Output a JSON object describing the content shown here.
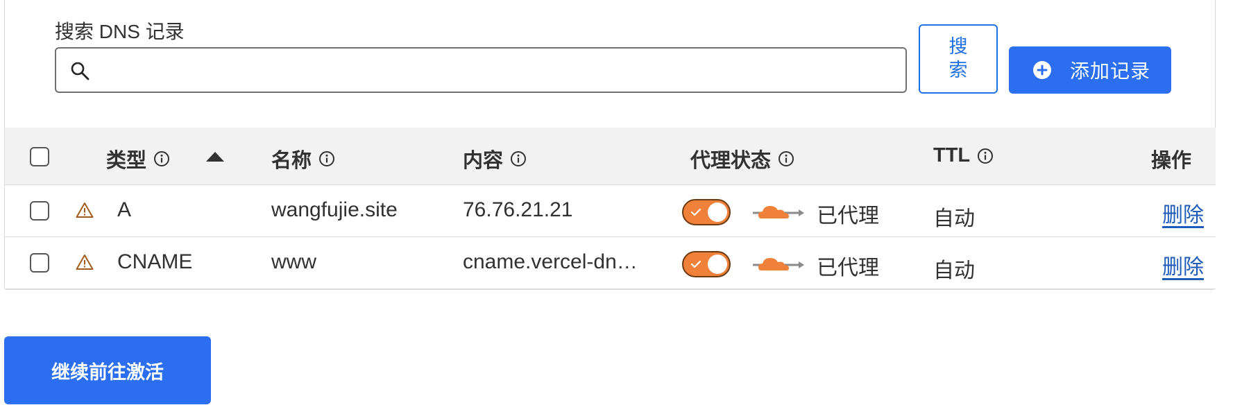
{
  "search": {
    "label": "搜索 DNS 记录",
    "value": "",
    "placeholder": "",
    "button_label": "搜\n索"
  },
  "add_record": {
    "label": "添加记录"
  },
  "table": {
    "headers": {
      "type": "类型",
      "name": "名称",
      "content": "内容",
      "proxy_status": "代理状态",
      "ttl": "TTL",
      "actions": "操作"
    },
    "rows": [
      {
        "type": "A",
        "name": "wangfujie.site",
        "content": "76.76.21.21",
        "proxy_status": "已代理",
        "ttl": "自动",
        "action": "删除",
        "proxied": true
      },
      {
        "type": "CNAME",
        "name": "www",
        "content": "cname.vercel-dn…",
        "proxy_status": "已代理",
        "ttl": "自动",
        "action": "删除",
        "proxied": true
      }
    ]
  },
  "continue_button": {
    "label": "继续前往激活"
  },
  "colors": {
    "primary": "#2b6ff0",
    "link": "#1f5bb8",
    "proxy_orange": "#f0813a",
    "warning": "#a15c1b"
  },
  "icons": [
    "search-icon",
    "plus-circle-icon",
    "info-icon",
    "sort-up-icon",
    "warning-icon",
    "check-icon",
    "proxy-cloud-icon"
  ]
}
